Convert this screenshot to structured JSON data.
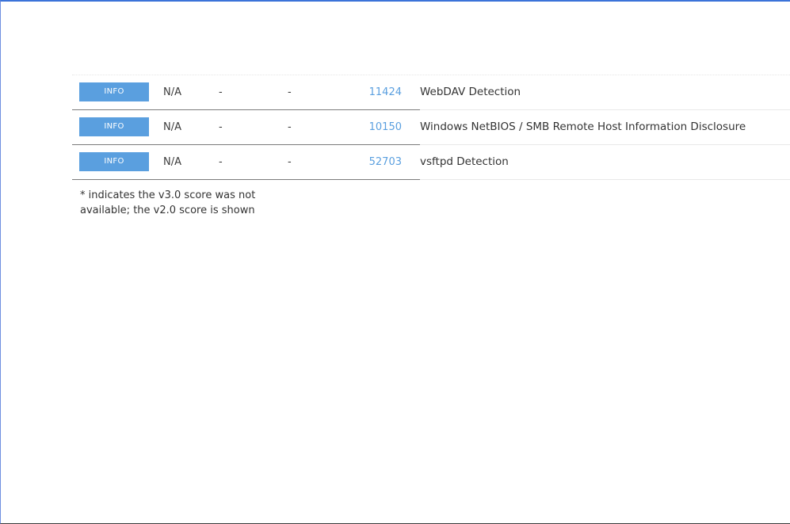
{
  "rows": [
    {
      "severity": "INFO",
      "cvss": "N/A",
      "vpr": "-",
      "epss": "-",
      "plugin_id": "11424",
      "name": "WebDAV Detection"
    },
    {
      "severity": "INFO",
      "cvss": "N/A",
      "vpr": "-",
      "epss": "-",
      "plugin_id": "10150",
      "name": "Windows NetBIOS / SMB Remote Host Information Disclosure"
    },
    {
      "severity": "INFO",
      "cvss": "N/A",
      "vpr": "-",
      "epss": "-",
      "plugin_id": "52703",
      "name": "vsftpd Detection"
    }
  ],
  "footnote": {
    "line1": "* indicates the v3.0 score was not",
    "line2": "available; the v2.0 score is shown"
  },
  "colors": {
    "info_badge": "#5a9fdf",
    "plugin_link": "#5a9fdf"
  }
}
